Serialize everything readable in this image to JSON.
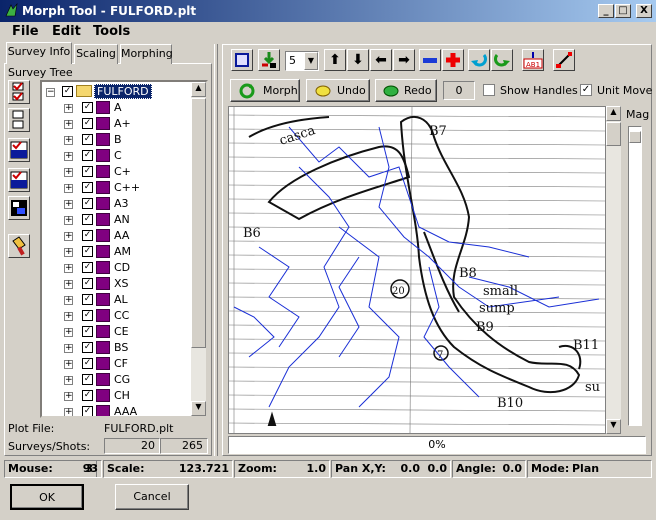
{
  "window": {
    "title": "Morph Tool - FULFORD.plt",
    "minimize": "_",
    "maximize": "□",
    "close": "X"
  },
  "menu": {
    "file": "File",
    "edit": "Edit",
    "tools": "Tools"
  },
  "tabs": {
    "survey_info": "Survey Info",
    "scaling": "Scaling",
    "morphing": "Morphing"
  },
  "survey_tree": {
    "label": "Survey Tree",
    "root": "FULFORD",
    "items": [
      "A",
      "A+",
      "B",
      "C",
      "C+",
      "C++",
      "A3",
      "AN",
      "AA",
      "AM",
      "CD",
      "XS",
      "AL",
      "CC",
      "CE",
      "BS",
      "CF",
      "CG",
      "CH",
      "AAA"
    ]
  },
  "plot_file": {
    "label": "Plot File:",
    "value": "FULFORD.plt"
  },
  "surveys_shots": {
    "label": "Surveys/Shots:",
    "surveys": "20",
    "shots": "265"
  },
  "toolbar": {
    "count_value": "5"
  },
  "actions": {
    "morph": "Morph",
    "undo": "Undo",
    "redo": "Redo",
    "counter": "0",
    "show_handles": "Show Handles",
    "unit_move": "Unit Move"
  },
  "mag_label": "Mag",
  "progress_text": "0%",
  "status": {
    "mouse_label": "Mouse:",
    "mouse_x": "3",
    "mouse_y": "93",
    "scale_label": "Scale:",
    "scale": "123.721",
    "zoom_label": "Zoom:",
    "zoom": "1.0",
    "pan_label": "Pan X,Y:",
    "pan_x": "0.0",
    "pan_y": "0.0",
    "angle_label": "Angle:",
    "angle": "0.0",
    "mode_label": "Mode:",
    "mode": "Plan"
  },
  "buttons": {
    "ok": "OK",
    "cancel": "Cancel"
  },
  "sketch_labels": {
    "b7": "B7",
    "b6": "B6",
    "b8": "B8",
    "b9": "B9",
    "b10": "B10",
    "b11": "B11",
    "small": "small",
    "sump": "sump",
    "su": "su",
    "n20": "20",
    "n7": "7",
    "casca": "casca"
  },
  "colors": {
    "title_start": "#0a246a",
    "title_end": "#a6caf0",
    "survey_line": "#1a2fd6",
    "sketch_ink": "#111111"
  }
}
